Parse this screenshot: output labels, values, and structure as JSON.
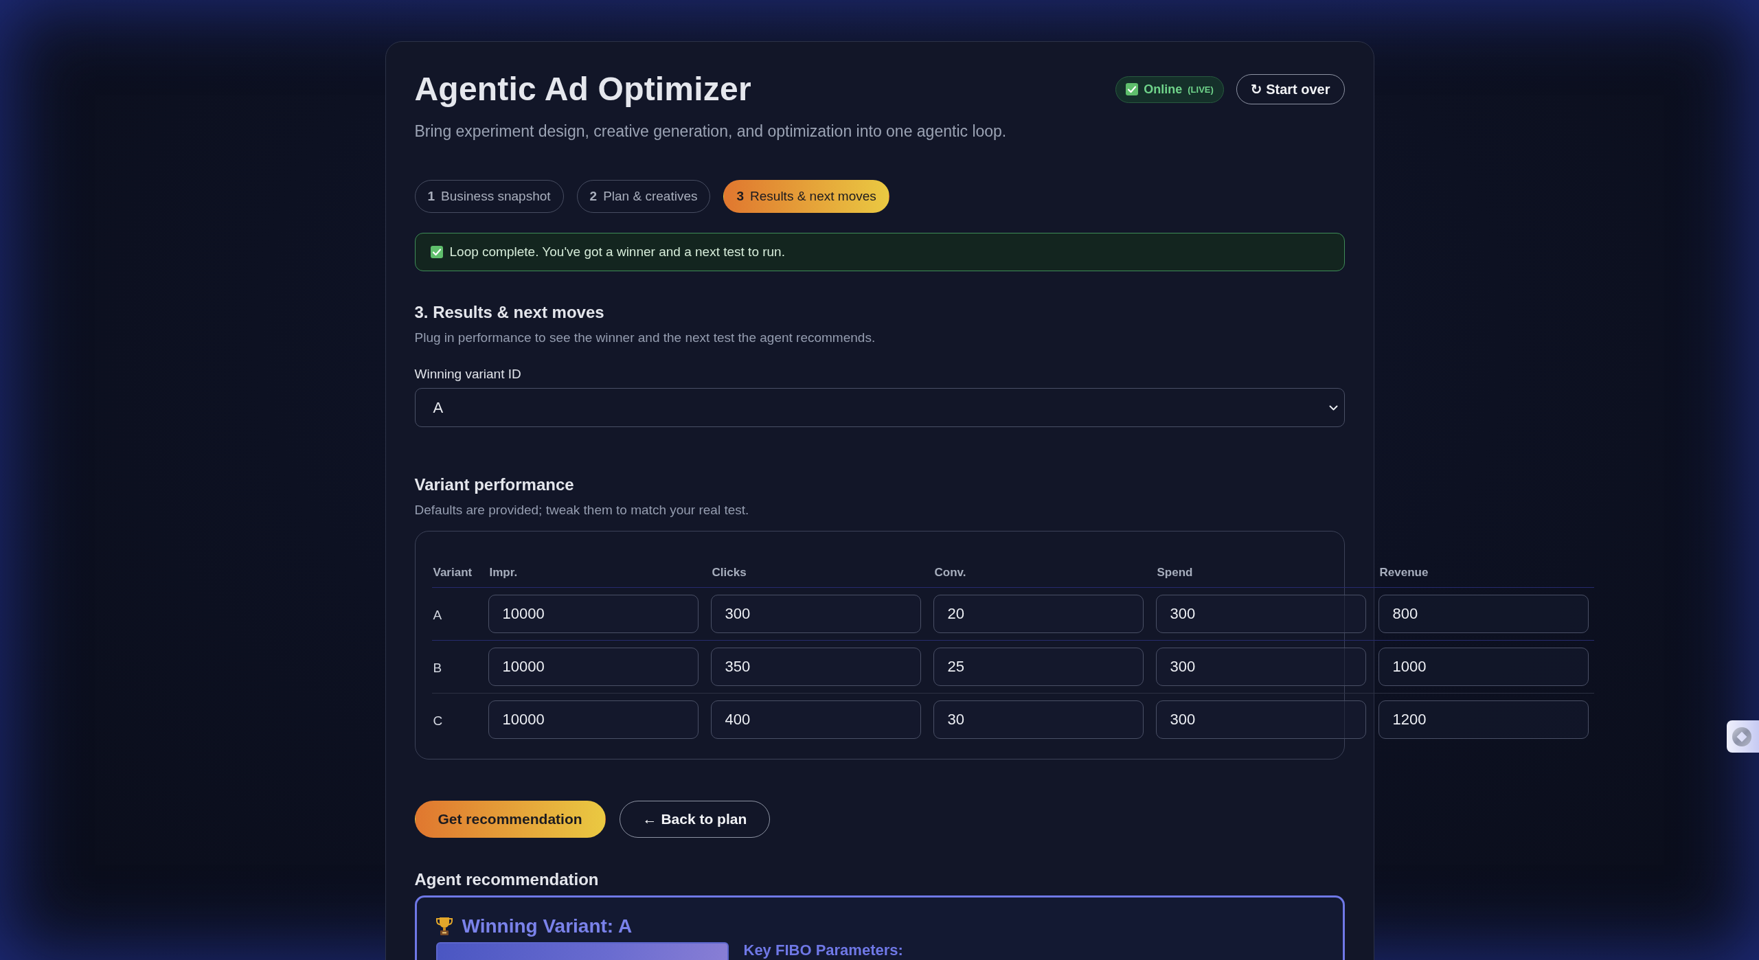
{
  "header": {
    "title": "Agentic Ad Optimizer",
    "subtitle": "Bring experiment design, creative generation, and optimization into one agentic loop.",
    "status": {
      "label": "Online",
      "tag": "(LIVE)"
    },
    "start_over": {
      "label": "↻ Start over"
    }
  },
  "steps": [
    {
      "number": "1",
      "label": "Business snapshot",
      "selected": false
    },
    {
      "number": "2",
      "label": "Plan & creatives",
      "selected": false
    },
    {
      "number": "3",
      "label": "Results & next moves",
      "selected": true
    }
  ],
  "banner": {
    "text": "Loop complete. You've got a winner and a next test to run."
  },
  "results": {
    "heading": "3. Results & next moves",
    "description": "Plug in performance to see the winner and the next test the agent recommends.",
    "winner_field": {
      "label": "Winning variant ID",
      "value": "A"
    }
  },
  "performance": {
    "heading": "Variant performance",
    "description": "Defaults are provided; tweak them to match your real test.",
    "columns": [
      "Variant",
      "Impr.",
      "Clicks",
      "Conv.",
      "Spend",
      "Revenue"
    ],
    "rows": [
      {
        "variant": "A",
        "values": [
          "10000",
          "300",
          "20",
          "300",
          "800"
        ]
      },
      {
        "variant": "B",
        "values": [
          "10000",
          "350",
          "25",
          "300",
          "1000"
        ]
      },
      {
        "variant": "C",
        "values": [
          "10000",
          "400",
          "30",
          "300",
          "1200"
        ]
      }
    ]
  },
  "actions": [
    {
      "label": "Get recommendation",
      "kind": "primary"
    },
    {
      "label": "← Back to plan",
      "kind": "secondary"
    }
  ],
  "recommendation": {
    "heading": "Agent recommendation",
    "title": "Winning Variant: A",
    "params_heading": "Key FIBO Parameters:"
  }
}
